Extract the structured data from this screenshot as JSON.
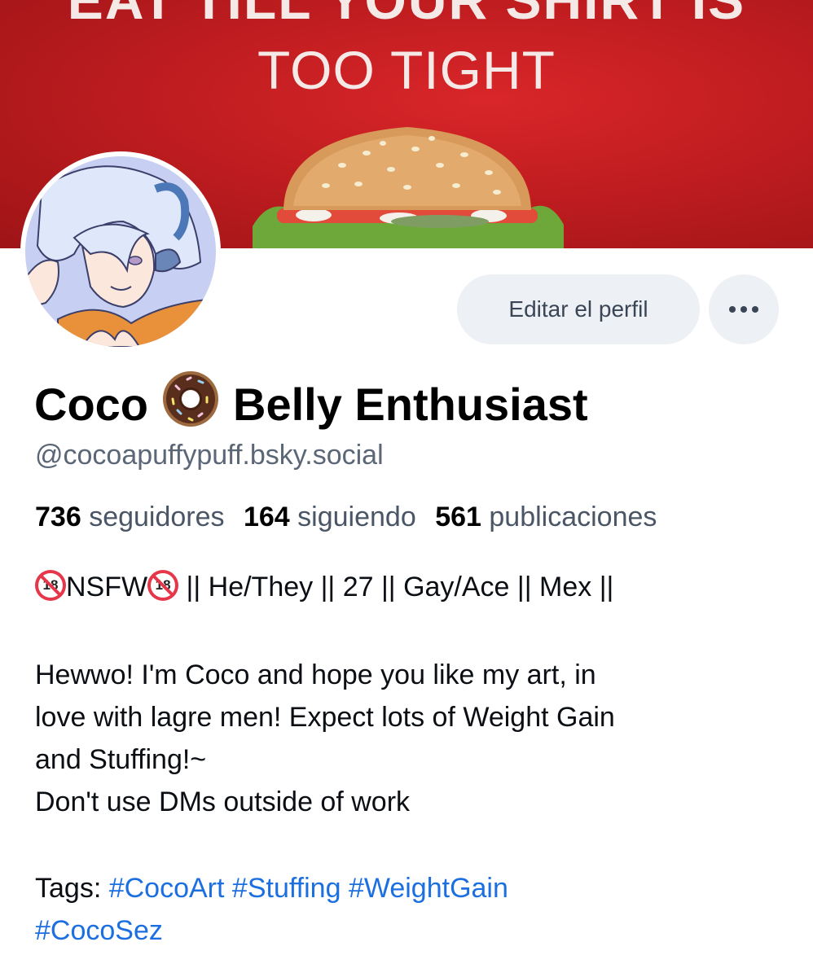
{
  "banner": {
    "text_top": "EAT TILL YOUR SHIRT IS",
    "text": "TOO TIGHT"
  },
  "profile": {
    "edit_button": "Editar el perfil",
    "more_icon": "ellipsis-icon",
    "name_part1": "Coco",
    "name_emoji": "donut-icon",
    "name_part2": "Belly Enthusiast",
    "handle": "@cocoapuffypuff.bsky.social",
    "stats": {
      "followers_count": "736",
      "followers_label": "seguidores",
      "following_count": "164",
      "following_label": "siguiendo",
      "posts_count": "561",
      "posts_label": "publicaciones"
    }
  },
  "bio": {
    "line1_nsfw": "NSFW",
    "line1_rest": " || He/They || 27 || Gay/Ace || Mex ||",
    "para1_line1": "Hewwo! I'm Coco and hope you like my art, in",
    "para1_line2": "love with lagre men! Expect lots of Weight Gain",
    "para1_line3": "and Stuffing!~",
    "para1_line4": "Don't use DMs outside of work",
    "tags_label": "Tags: ",
    "tags": [
      "#CocoArt",
      "#Stuffing",
      "#WeightGain",
      "#CocoSez"
    ]
  },
  "colors": {
    "banner_red": "#c01d20",
    "link_blue": "#1c6fe0",
    "button_bg": "#edf0f4"
  }
}
